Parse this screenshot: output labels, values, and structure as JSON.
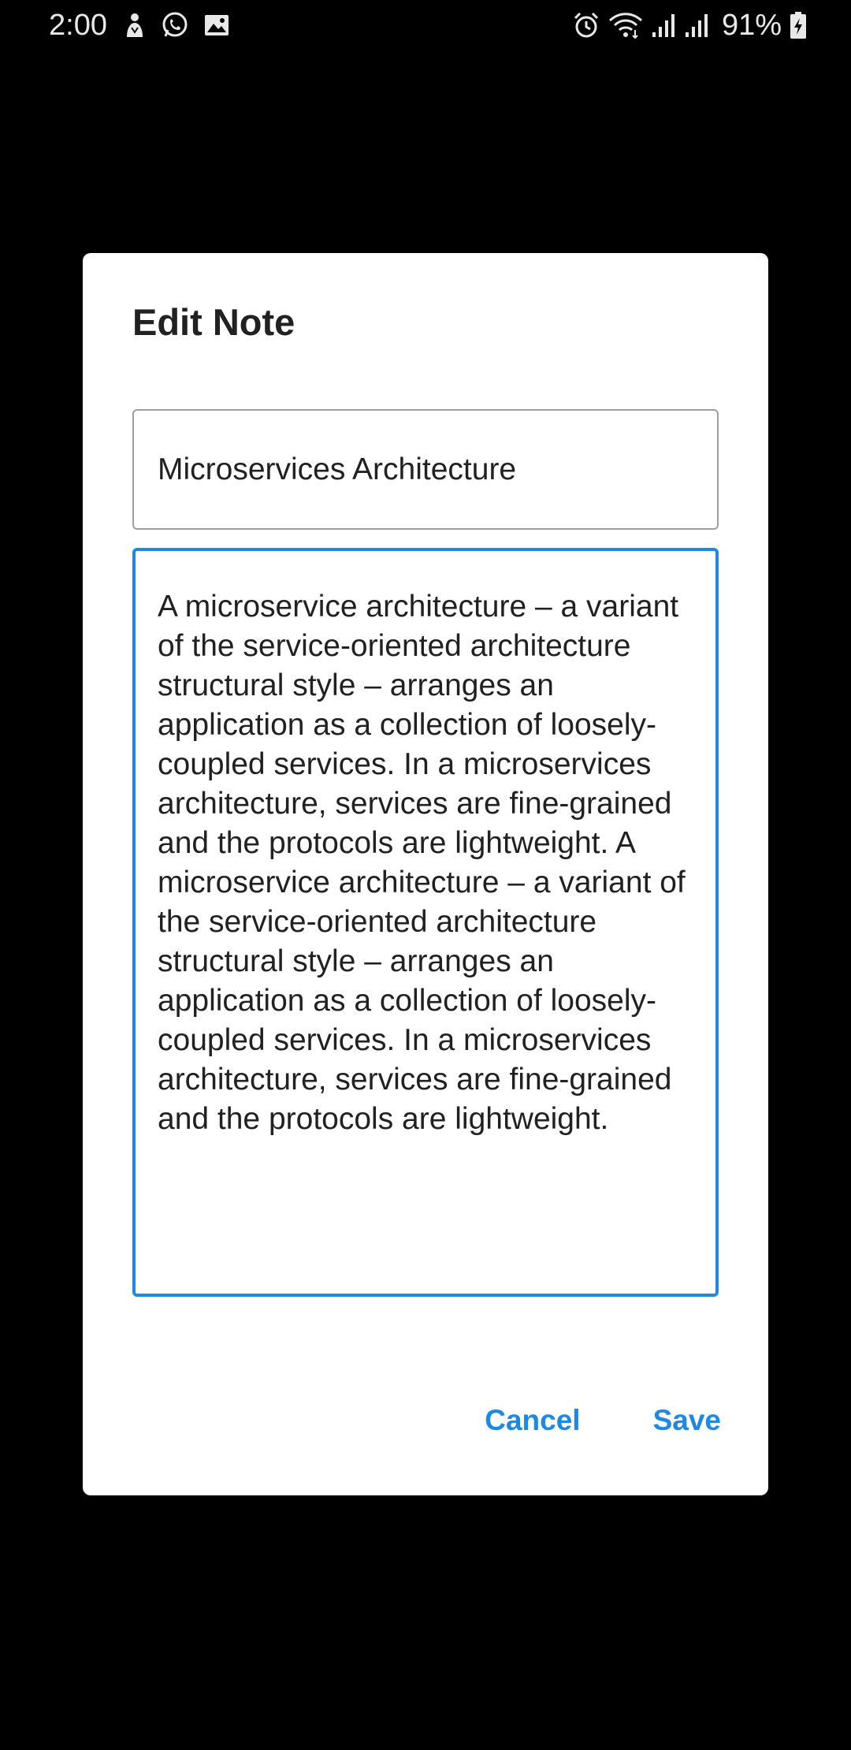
{
  "status_bar": {
    "time": "2:00",
    "battery_percent": "91%",
    "left_icons": [
      "tor-icon",
      "whatsapp-icon",
      "gallery-icon"
    ],
    "right_icons": [
      "alarm-icon",
      "wifi-icon",
      "signal-icon",
      "signal-icon",
      "battery-charging-icon"
    ]
  },
  "dialog": {
    "title": "Edit Note",
    "note_title": "Microservices Architecture",
    "note_body": "A microservice architecture – a variant of the service-oriented architecture structural style – arranges an application as a collection of loosely-coupled services. In a microservices architecture, services are fine-grained and the protocols are lightweight. A microservice architecture – a variant of the service-oriented architecture structural style – arranges an application as a collection of loosely-coupled services. In a microservices architecture, services are fine-grained and the protocols are lightweight.",
    "cancel_label": "Cancel",
    "save_label": "Save",
    "accent_color": "#1e88e5"
  }
}
